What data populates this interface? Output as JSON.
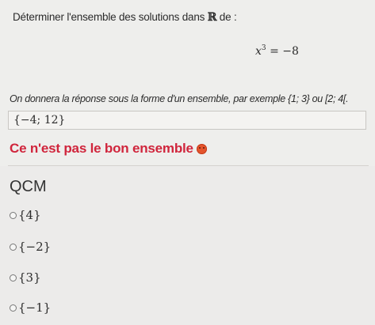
{
  "question": {
    "prompt_text": "Déterminer l'ensemble des solutions dans",
    "set_symbol": "ℝ",
    "prompt_suffix": "de :",
    "equation_base": "x",
    "equation_exponent": "3",
    "equation_rest": "= −8",
    "hint": "On donnera la réponse sous la forme d'un ensemble, par exemple {1; 3} ou [2; 4[.",
    "answer_value": "{−4; 12}",
    "feedback": "Ce n'est pas le bon ensemble",
    "feedback_color": "#d0253c"
  },
  "qcm": {
    "title": "QCM",
    "options": [
      "{4}",
      "{−2}",
      "{3}",
      "{−1}"
    ]
  }
}
